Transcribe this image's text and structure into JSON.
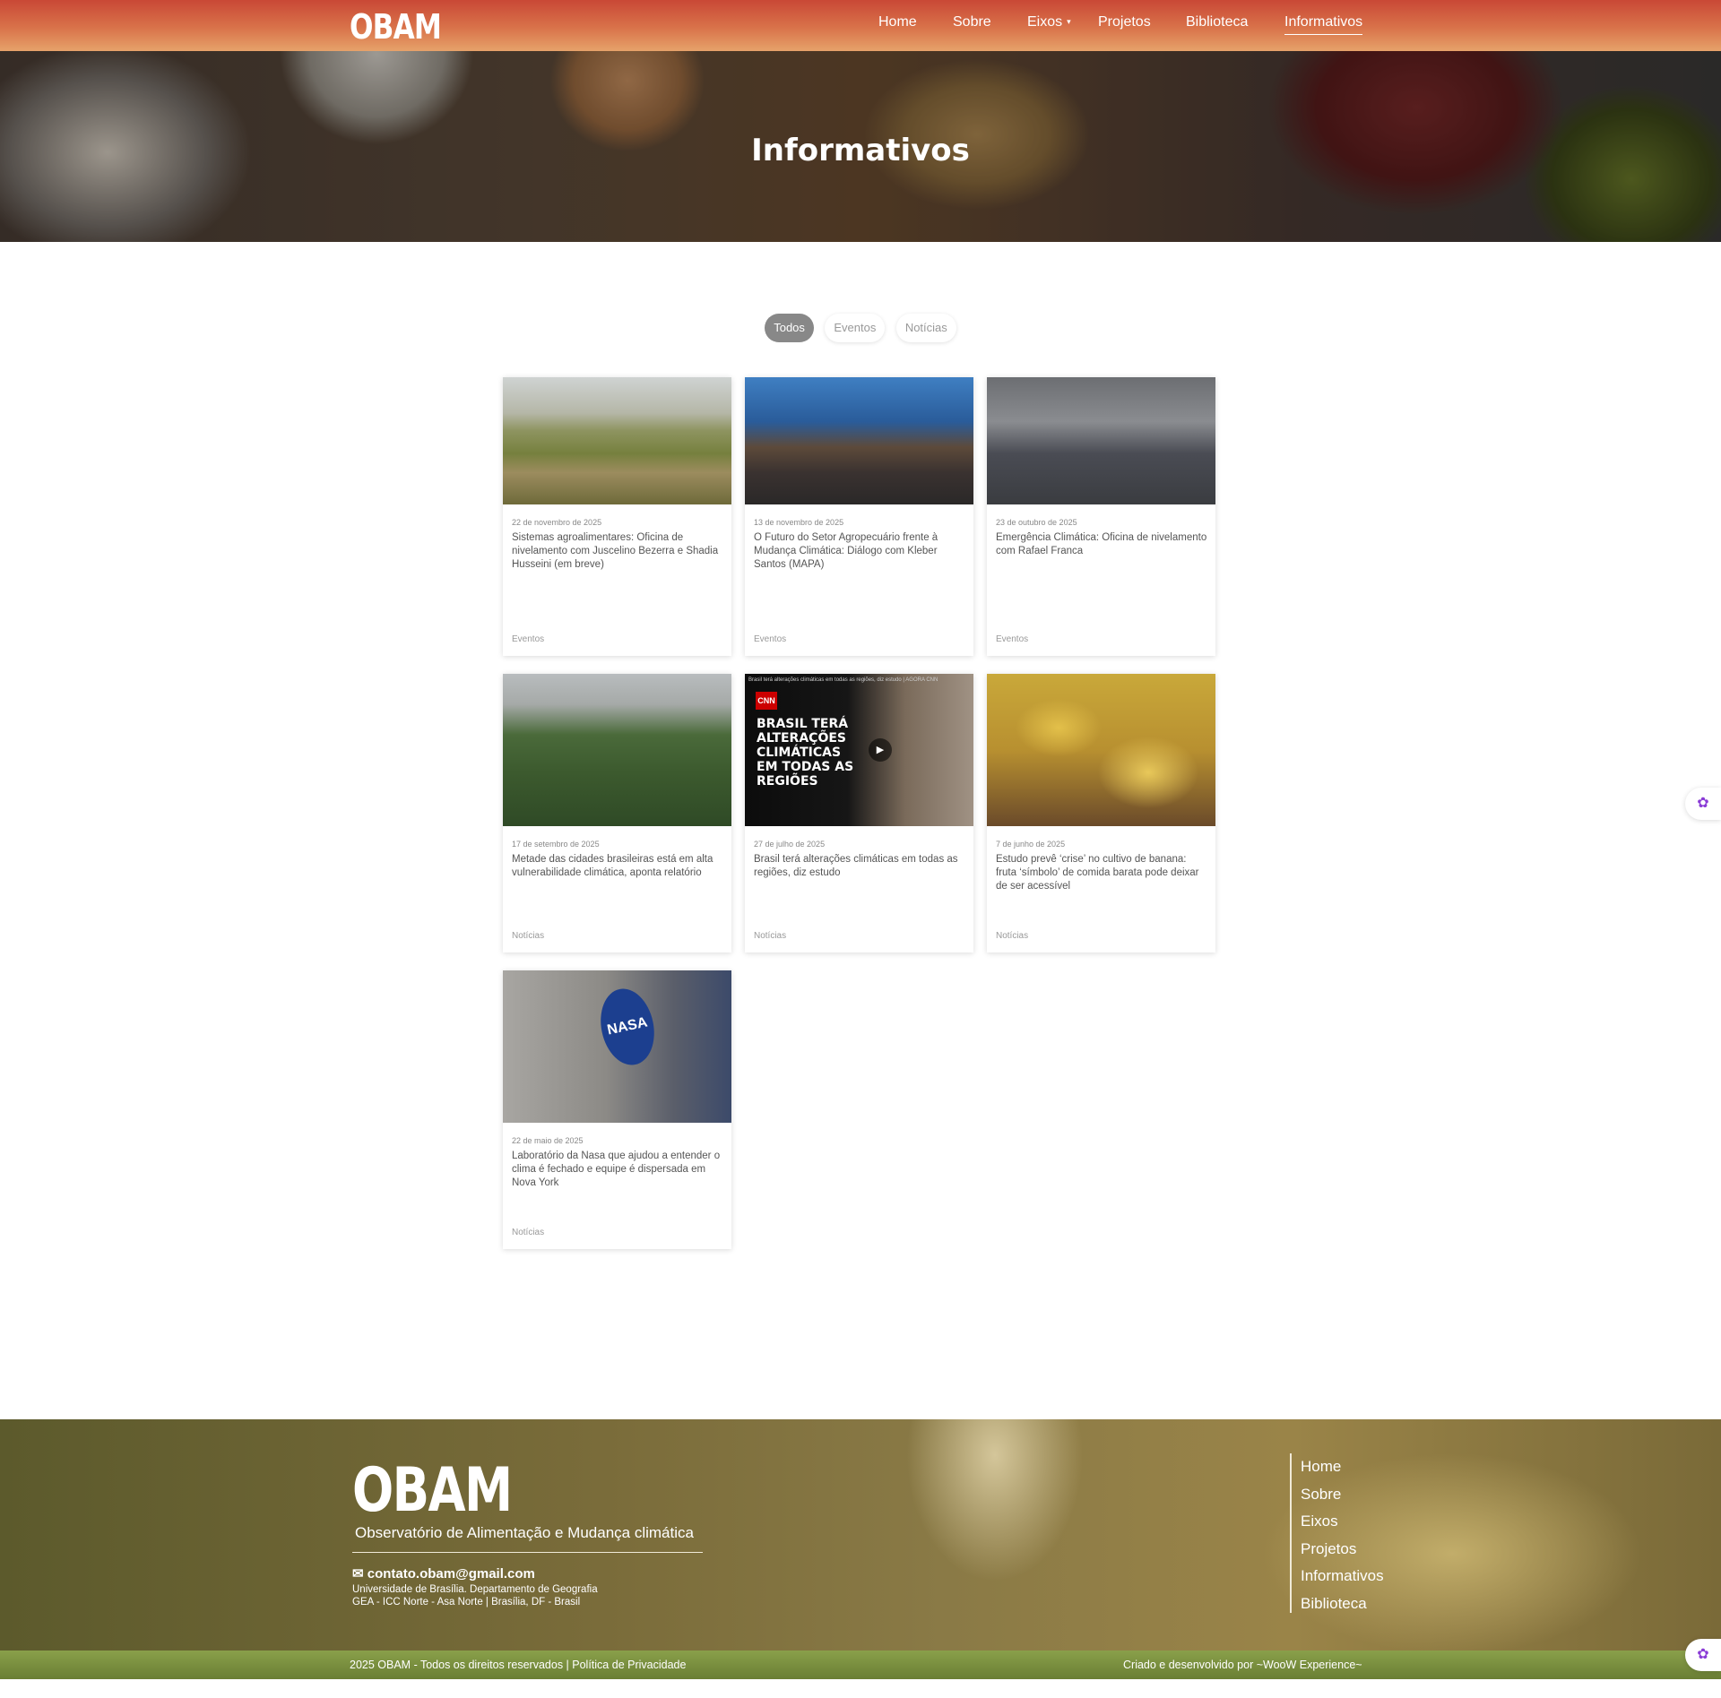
{
  "header": {
    "logo": "OBAM",
    "nav": [
      {
        "label": "Home"
      },
      {
        "label": "Sobre"
      },
      {
        "label": "Eixos"
      },
      {
        "label": "Projetos"
      },
      {
        "label": "Biblioteca"
      },
      {
        "label": "Informativos"
      }
    ],
    "active_nav": "Informativos",
    "hero_title": "Informativos"
  },
  "filters": [
    "Todos",
    "Eventos",
    "Notícias"
  ],
  "active_filter": "Todos",
  "cards": [
    {
      "date": "22 de novembro de 2025",
      "title": "Sistemas agroalimentares: Oficina de nivelamento com Juscelino Bezerra e Shadia Husseini (em breve)",
      "tag": "Eventos"
    },
    {
      "date": "13 de novembro de 2025",
      "title": "O Futuro do Setor Agropecuário frente à Mudança Climática: Diálogo com Kleber Santos (MAPA)",
      "tag": "Eventos"
    },
    {
      "date": "23 de outubro de 2025",
      "title": "Emergência Climática: Oficina de nivelamento com Rafael Franca",
      "tag": "Eventos"
    },
    {
      "date": "17 de setembro de 2025",
      "title": "Metade das cidades brasileiras está em alta vulnerabilidade climática, aponta relatório",
      "tag": "Notícias"
    },
    {
      "date": "27 de julho de 2025",
      "title": "Brasil terá alterações climáticas em todas as regiões, diz estudo",
      "tag": "Notícias"
    },
    {
      "date": "7 de junho de 2025",
      "title": "Estudo prevê ‘crise’ no cultivo de banana: fruta ‘símbolo’ de comida barata pode deixar de ser acessível",
      "tag": "Notícias"
    },
    {
      "date": "22 de maio de 2025",
      "title": "Laboratório da Nasa que ajudou a entender o clima é fechado e equipe é dispersada em Nova York",
      "tag": "Notícias"
    }
  ],
  "cnn_thumb": {
    "caption": "Brasil terá alterações climáticas em todas as regiões, diz estudo | AGORA CNN",
    "logo": "CNN",
    "headline": "BRASIL TERÁ ALTERAÇÕES CLIMÁTICAS EM TODAS AS REGIÕES"
  },
  "nasa_thumb": {
    "logo": "NASA"
  },
  "footer": {
    "logo": "OBAM",
    "tagline": "Observatório de Alimentação e Mudança climática",
    "email": "contato.obam@gmail.com",
    "address_line1": "Universidade de Brasília. Departamento de Geografia",
    "address_line2": "GEA - ICC Norte - Asa Norte | Brasília, DF - Brasil",
    "links": [
      "Home",
      "Sobre",
      "Eixos",
      "Projetos",
      "Informativos",
      "Biblioteca"
    ],
    "copyright": "2025 OBAM - Todos os direitos reservados | Política de Privacidade",
    "credits": "Criado e desenvolvido por ~WooW Experience~"
  },
  "colors": {
    "topbar": "#c94836",
    "filter_active": "#888888",
    "copybar": "#7a8e3c"
  },
  "icons": [
    "chevron-down-icon",
    "play-icon",
    "mail-icon",
    "brain-widget-icon"
  ]
}
